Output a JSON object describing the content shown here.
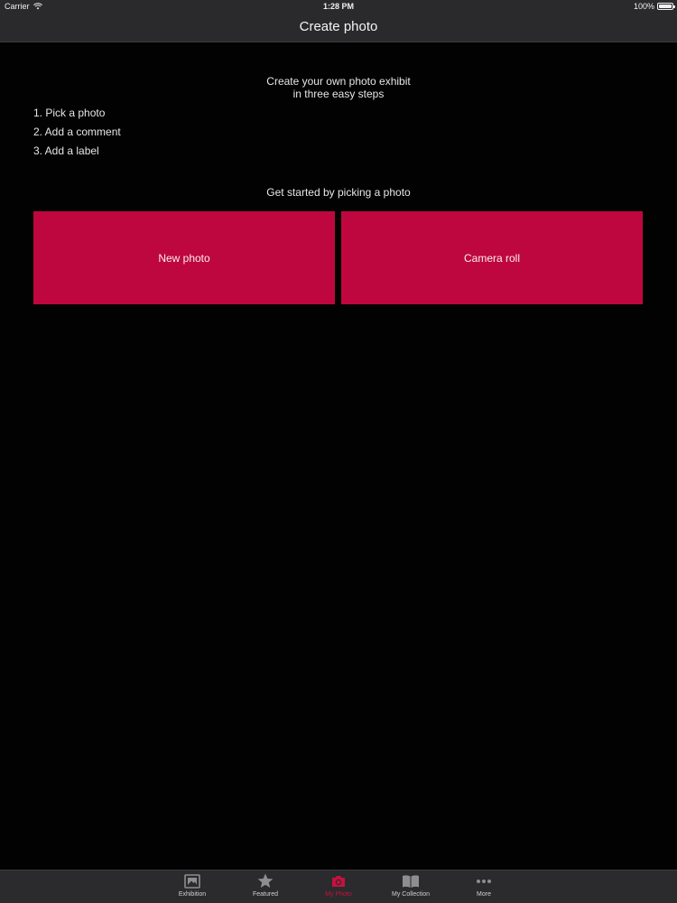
{
  "status": {
    "carrier": "Carrier",
    "time": "1:28 PM",
    "battery": "100%"
  },
  "nav": {
    "title": "Create photo"
  },
  "intro": {
    "line1": "Create your own photo exhibit",
    "line2": "in three easy steps"
  },
  "steps": [
    "1. Pick a photo",
    "2. Add a comment",
    "3. Add a label"
  ],
  "prompt": "Get started by picking a photo",
  "buttons": {
    "new_photo": "New photo",
    "camera_roll": "Camera roll"
  },
  "tabs": [
    {
      "label": "Exhibition",
      "icon": "picture-frame-icon"
    },
    {
      "label": "Featured",
      "icon": "star-icon"
    },
    {
      "label": "My Photo",
      "icon": "camera-icon",
      "active": true
    },
    {
      "label": "My Collection",
      "icon": "book-icon"
    },
    {
      "label": "More",
      "icon": "more-dots-icon"
    }
  ],
  "colors": {
    "accent": "#bf073f",
    "active_tab": "#c8103f",
    "bar_background": "#2a2a2c",
    "background": "#020203"
  }
}
